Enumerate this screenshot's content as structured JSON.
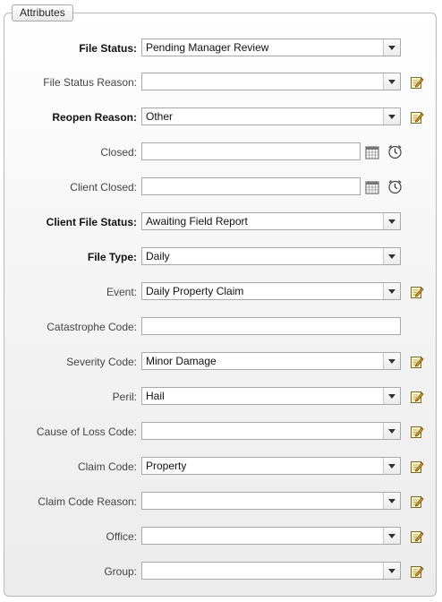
{
  "legend": "Attributes",
  "fields": [
    {
      "label": "File Status:",
      "bold": true,
      "kind": "select",
      "value": "Pending Manager Review",
      "edit": false
    },
    {
      "label": "File Status Reason:",
      "bold": false,
      "kind": "select",
      "value": "",
      "edit": true
    },
    {
      "label": "Reopen Reason:",
      "bold": true,
      "kind": "select",
      "value": "Other",
      "edit": true
    },
    {
      "label": "Closed:",
      "bold": false,
      "kind": "date",
      "value": "",
      "edit": false
    },
    {
      "label": "Client Closed:",
      "bold": false,
      "kind": "date",
      "value": "",
      "edit": false
    },
    {
      "label": "Client File Status:",
      "bold": true,
      "kind": "select",
      "value": "Awaiting Field Report",
      "edit": false
    },
    {
      "label": "File Type:",
      "bold": true,
      "kind": "select",
      "value": "Daily",
      "edit": false
    },
    {
      "label": "Event:",
      "bold": false,
      "kind": "select",
      "value": "Daily Property Claim",
      "edit": true
    },
    {
      "label": "Catastrophe Code:",
      "bold": false,
      "kind": "text",
      "value": "",
      "edit": false
    },
    {
      "label": "Severity Code:",
      "bold": false,
      "kind": "select",
      "value": "Minor Damage",
      "edit": true
    },
    {
      "label": "Peril:",
      "bold": false,
      "kind": "select",
      "value": "Hail",
      "edit": true
    },
    {
      "label": "Cause of Loss Code:",
      "bold": false,
      "kind": "select",
      "value": "",
      "edit": true
    },
    {
      "label": "Claim Code:",
      "bold": false,
      "kind": "select",
      "value": "Property",
      "edit": true
    },
    {
      "label": "Claim Code Reason:",
      "bold": false,
      "kind": "select",
      "value": "",
      "edit": true
    },
    {
      "label": "Office:",
      "bold": false,
      "kind": "select",
      "value": "",
      "edit": true
    },
    {
      "label": "Group:",
      "bold": false,
      "kind": "select",
      "value": "",
      "edit": true
    }
  ],
  "icons": {
    "edit": "edit-note-icon",
    "calendar": "calendar-icon",
    "clock": "clock-icon"
  }
}
